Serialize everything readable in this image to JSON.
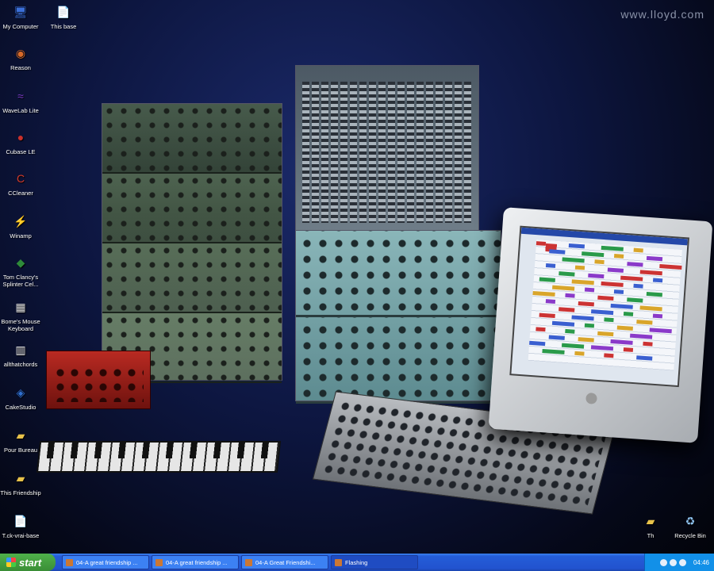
{
  "watermark": "www.lloyd.com",
  "desktop_icons": [
    {
      "label": "My Computer",
      "icon": "computer-icon"
    },
    {
      "label": "This base",
      "icon": "document-icon"
    },
    {
      "label": "Reason",
      "icon": "reason-icon"
    },
    {
      "label": "WaveLab Lite",
      "icon": "wavelab-icon"
    },
    {
      "label": "Cubase LE",
      "icon": "cubase-icon"
    },
    {
      "label": "CCleaner",
      "icon": "ccleaner-icon"
    },
    {
      "label": "Winamp",
      "icon": "winamp-icon"
    },
    {
      "label": "Tom Clancy's Splinter Cel...",
      "icon": "game-icon"
    },
    {
      "label": "Bome's Mouse Keyboard",
      "icon": "keyboard-icon"
    },
    {
      "label": "allthatchords",
      "icon": "piano-icon"
    },
    {
      "label": "CakeStudio",
      "icon": "cakestudio-icon"
    },
    {
      "label": "Pour Bureau",
      "icon": "folder-icon"
    },
    {
      "label": "This Friendship",
      "icon": "folder-icon"
    },
    {
      "label": "T.ck-vrai-base",
      "icon": "document-icon"
    },
    {
      "label": "Th",
      "icon": "folder-icon"
    },
    {
      "label": "Recycle Bin",
      "icon": "recycle-bin-icon"
    }
  ],
  "taskbar": {
    "start_label": "start",
    "tasks": [
      {
        "label": "04-A great friendship ...",
        "active": false
      },
      {
        "label": "04-A great friendship ...",
        "active": false
      },
      {
        "label": "04-A Great Friendshi...",
        "active": false
      },
      {
        "label": "Flashing",
        "active": true
      }
    ],
    "clock": "04:46"
  },
  "colors": {
    "taskbar": "#245dd8",
    "start": "#3a8e36",
    "tray": "#1290e8"
  }
}
